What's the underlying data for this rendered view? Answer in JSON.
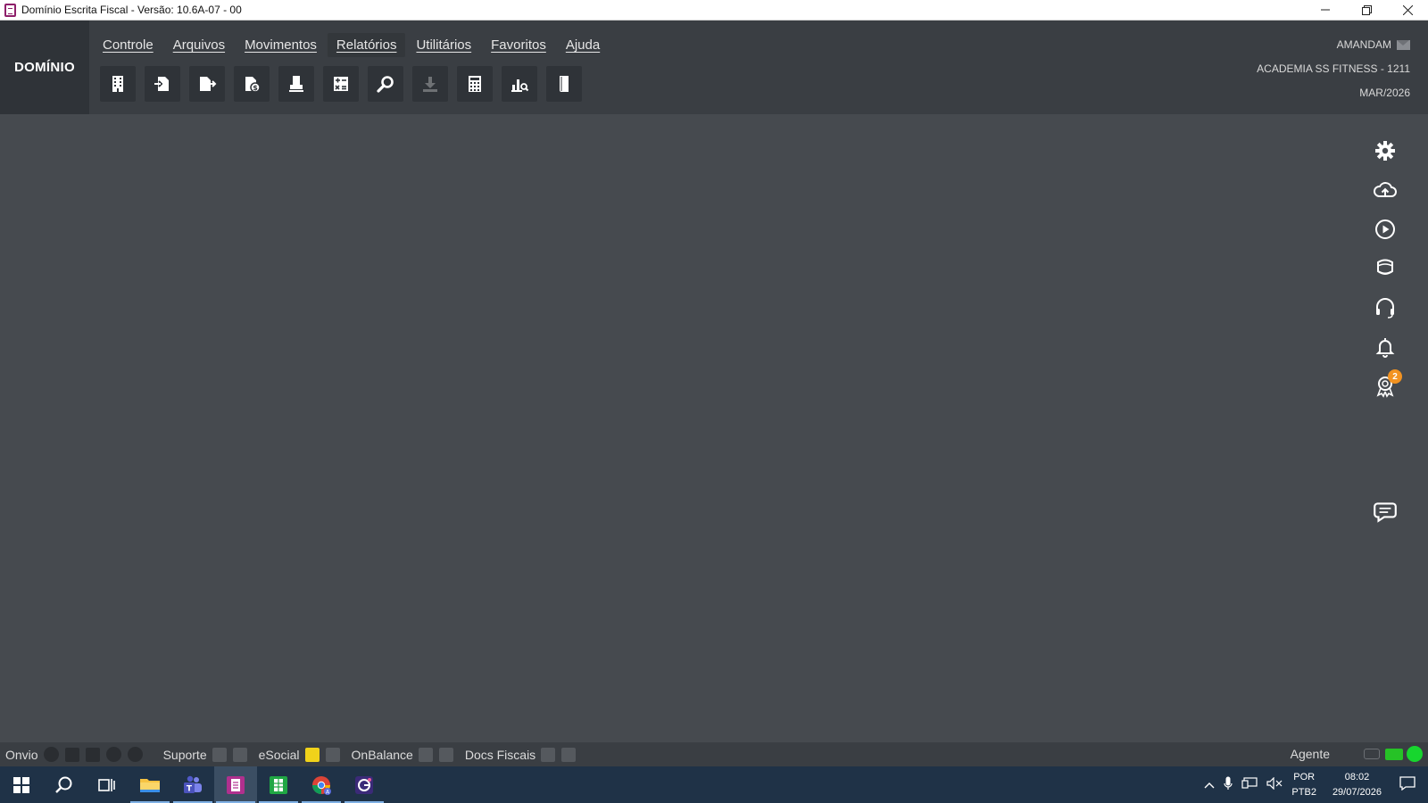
{
  "window": {
    "title": "Domínio Escrita Fiscal  - Versão: 10.6A-07 - 00",
    "controls": [
      "minimize",
      "restore",
      "close"
    ]
  },
  "brand": "DOMÍNIO",
  "menu": [
    {
      "label": "Controle"
    },
    {
      "label": "Arquivos"
    },
    {
      "label": "Movimentos"
    },
    {
      "label": "Relatórios",
      "active": true
    },
    {
      "label": "Utilitários"
    },
    {
      "label": "Favoritos"
    },
    {
      "label": "Ajuda"
    }
  ],
  "toolbar": [
    {
      "icon": "building-icon"
    },
    {
      "icon": "document-in-icon"
    },
    {
      "icon": "document-out-icon"
    },
    {
      "icon": "document-money-icon"
    },
    {
      "icon": "printer-stamp-icon"
    },
    {
      "icon": "calculator-sheet-icon"
    },
    {
      "icon": "search-icon"
    },
    {
      "icon": "download-icon",
      "disabled": true
    },
    {
      "icon": "calculator-icon"
    },
    {
      "icon": "chart-search-icon"
    },
    {
      "icon": "book-icon"
    }
  ],
  "user": {
    "name": "AMANDAM",
    "company": "ACADEMIA SS FITNESS  - 1211",
    "period": "MAR/2026"
  },
  "side_icons": [
    {
      "icon": "gear-icon"
    },
    {
      "icon": "cloud-upload-icon"
    },
    {
      "icon": "play-icon"
    },
    {
      "icon": "graduation-icon"
    },
    {
      "icon": "headset-icon"
    },
    {
      "icon": "bell-icon"
    },
    {
      "icon": "award-icon",
      "badge": "2"
    }
  ],
  "chat_icon": "chat-icon",
  "statusbar": {
    "onvio": "Onvio",
    "suporte": "Suporte",
    "esocial": "eSocial",
    "onbalance": "OnBalance",
    "docs_fiscais": "Docs Fiscais",
    "agente": "Agente"
  },
  "taskbar": {
    "lang_top": "POR",
    "lang_bottom": "PTB2",
    "time": "08:02",
    "date": "29/07/2026"
  },
  "colors": {
    "workspace": "#464a4f",
    "header": "#3a3e43",
    "brand_bg": "#2f3338",
    "taskbar": "#1f3247",
    "badge": "#f29321",
    "status_green": "#17d62e",
    "app_accent": "#8e1f6a"
  }
}
